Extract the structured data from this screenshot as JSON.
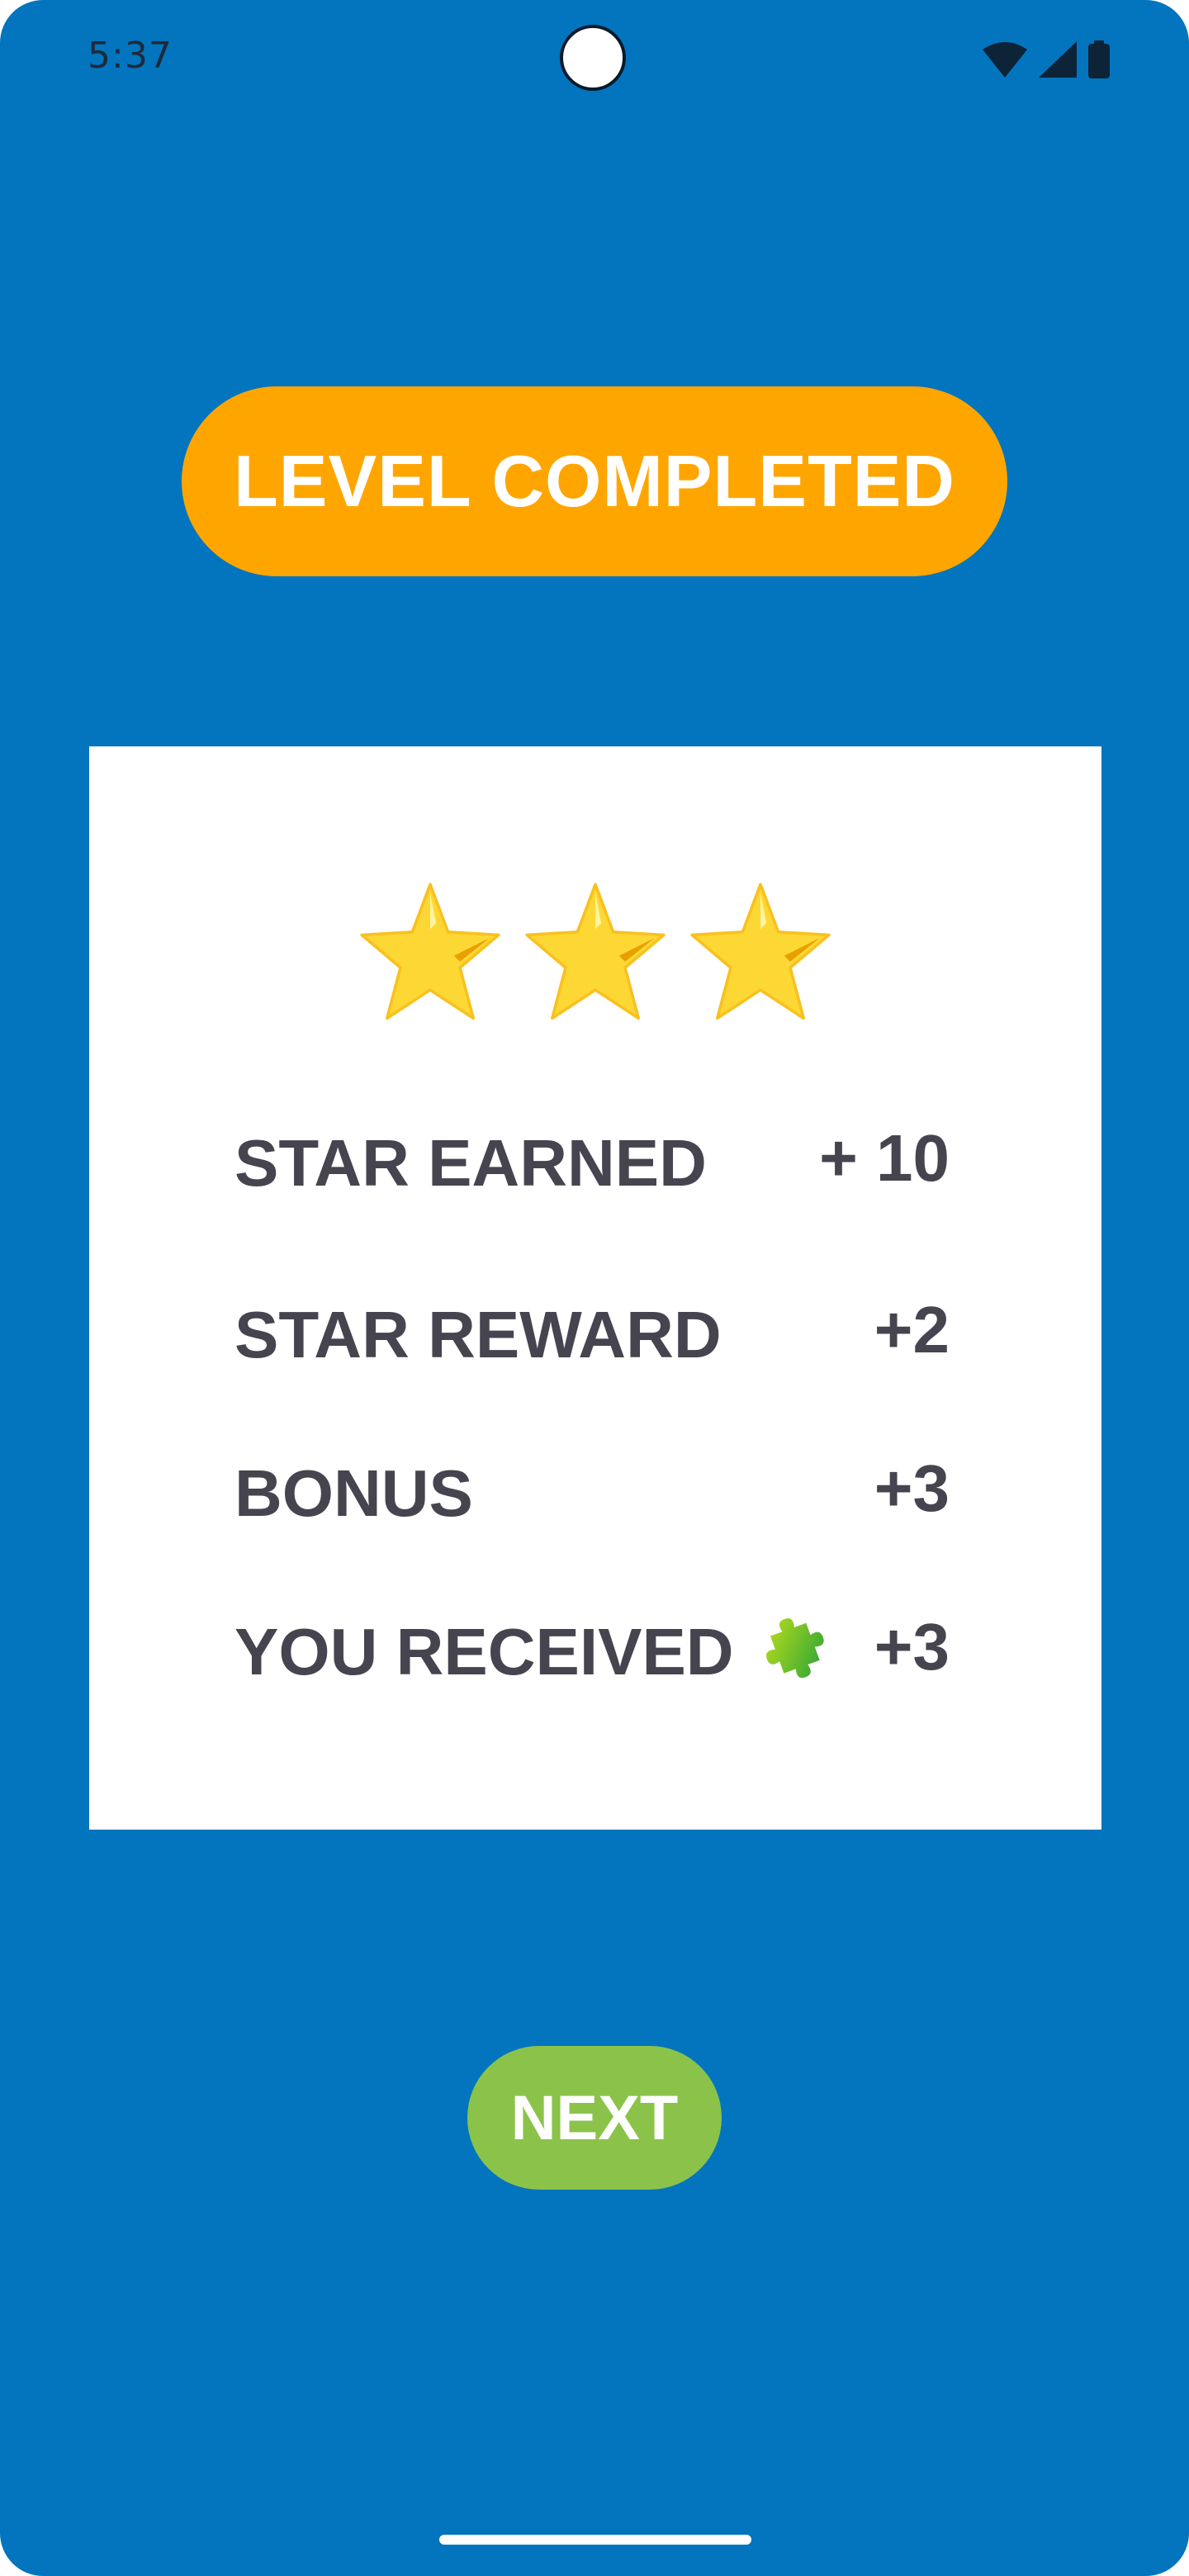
{
  "status_bar": {
    "time": "5:37",
    "icons": [
      "wifi-icon",
      "signal-icon",
      "battery-icon"
    ]
  },
  "banner": {
    "title": "LEVEL COMPLETED"
  },
  "rating": {
    "stars_earned": 3,
    "stars_total": 3
  },
  "results": {
    "star_earned": {
      "label": "STAR EARNED",
      "value": "+ 10"
    },
    "star_reward": {
      "label": "STAR REWARD",
      "value": "+2"
    },
    "bonus": {
      "label": "BONUS",
      "value": "+3"
    },
    "you_received": {
      "label": "YOU RECEIVED",
      "value": "+3",
      "icon": "puzzle-piece-icon"
    }
  },
  "actions": {
    "next_label": "NEXT"
  },
  "colors": {
    "background": "#0275BE",
    "banner": "#FFA500",
    "card": "#FFFFFF",
    "text": "#46444F",
    "next_button": "#8BC34A",
    "star": "#FDD835"
  }
}
